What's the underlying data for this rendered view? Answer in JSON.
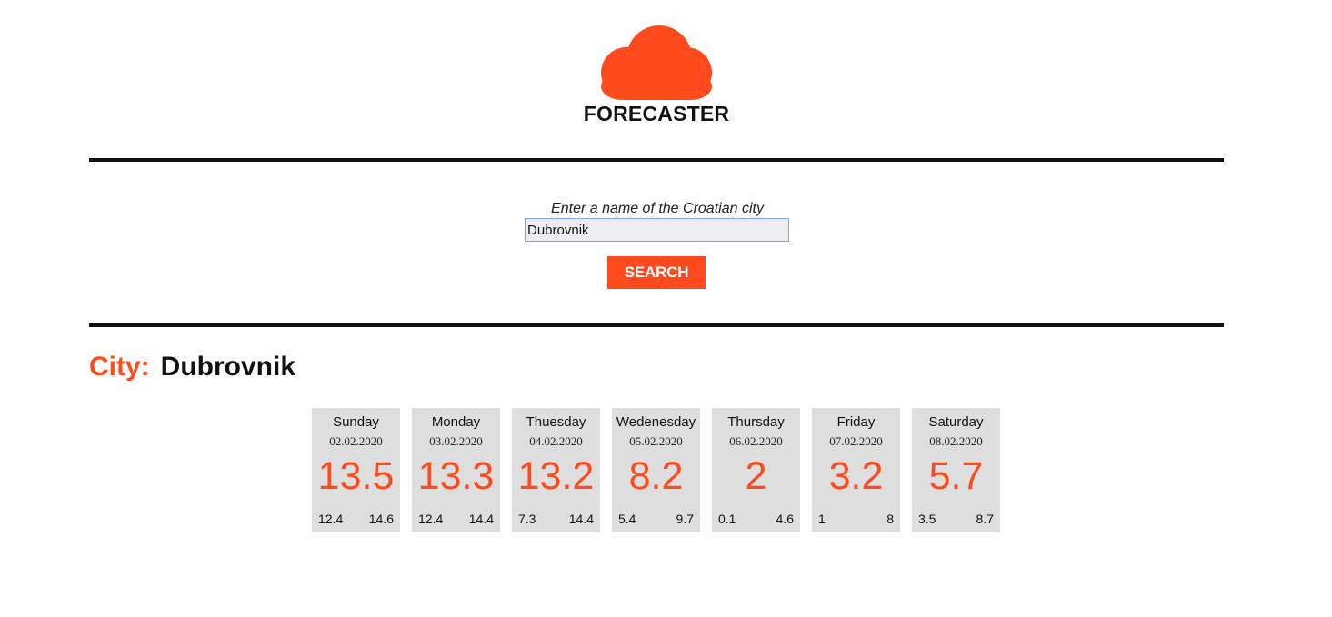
{
  "brand": {
    "name": "FORECASTER",
    "icon": "cloud-icon",
    "color": "#ff4a1d"
  },
  "search": {
    "label": "Enter a name of the Croatian city",
    "value": "Dubrovnik",
    "button_label": "SEARCH"
  },
  "city": {
    "label": "City:",
    "name": "Dubrovnik"
  },
  "days": [
    {
      "name": "Sunday",
      "date": "02.02.2020",
      "temp": "13.5",
      "min": "12.4",
      "max": "14.6"
    },
    {
      "name": "Monday",
      "date": "03.02.2020",
      "temp": "13.3",
      "min": "12.4",
      "max": "14.4"
    },
    {
      "name": "Thuesday",
      "date": "04.02.2020",
      "temp": "13.2",
      "min": "7.3",
      "max": "14.4"
    },
    {
      "name": "Wedenesday",
      "date": "05.02.2020",
      "temp": "8.2",
      "min": "5.4",
      "max": "9.7"
    },
    {
      "name": "Thursday",
      "date": "06.02.2020",
      "temp": "2",
      "min": "0.1",
      "max": "4.6"
    },
    {
      "name": "Friday",
      "date": "07.02.2020",
      "temp": "3.2",
      "min": "1",
      "max": "8"
    },
    {
      "name": "Saturday",
      "date": "08.02.2020",
      "temp": "5.7",
      "min": "3.5",
      "max": "8.7"
    }
  ]
}
